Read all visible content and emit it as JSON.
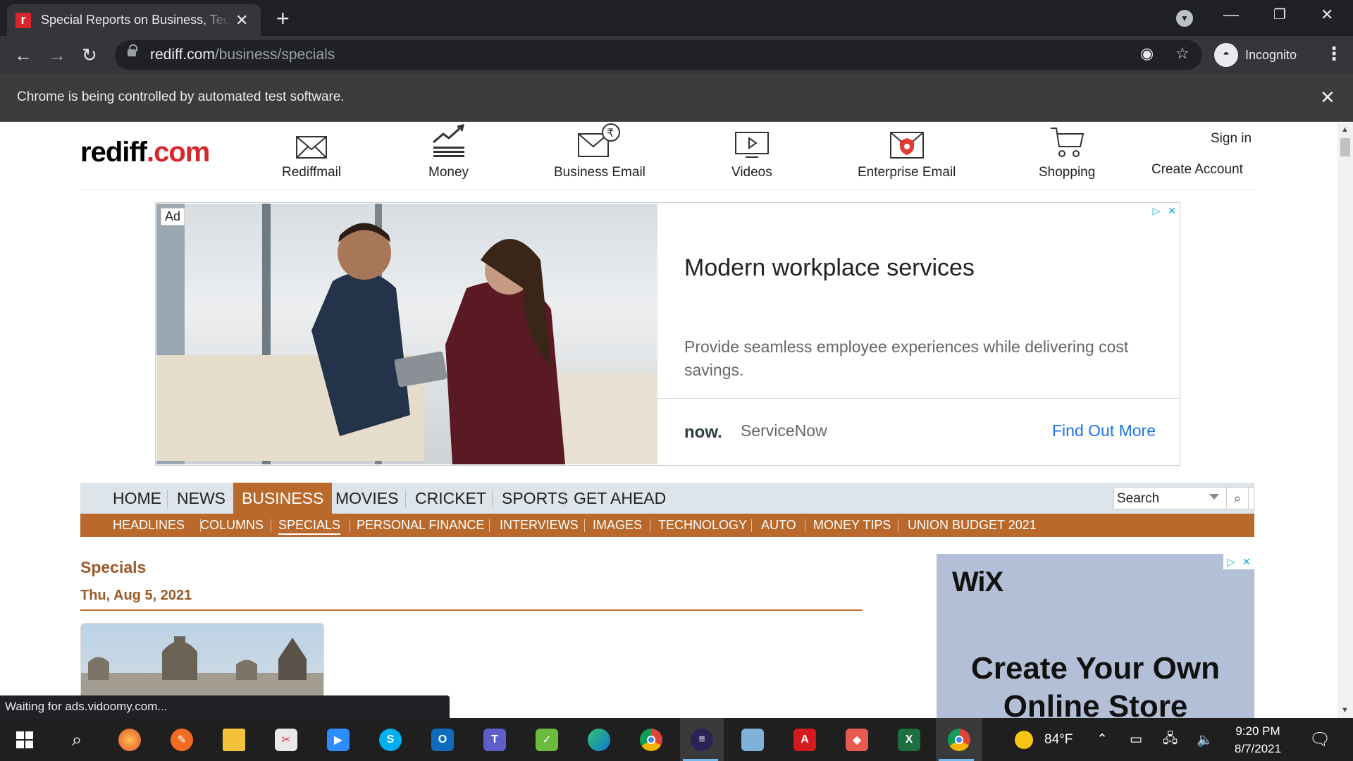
{
  "browser": {
    "tab_title": "Special Reports on Business, Tech",
    "url_host": "rediff.com",
    "url_path": "/business/specials",
    "profile_label": "Incognito",
    "infobar_text": "Chrome is being controlled by automated test software."
  },
  "header": {
    "logo_main": "rediff",
    "logo_tld": ".com",
    "nav": [
      {
        "label": "Rediffmail",
        "icon": "mail-icon"
      },
      {
        "label": "Money",
        "icon": "money-chart-icon"
      },
      {
        "label": "Business Email",
        "icon": "business-email-icon"
      },
      {
        "label": "Videos",
        "icon": "video-icon"
      },
      {
        "label": "Enterprise Email",
        "icon": "enterprise-email-icon"
      },
      {
        "label": "Shopping",
        "icon": "cart-icon"
      }
    ],
    "sign_in": "Sign in",
    "create_account": "Create Account"
  },
  "ad": {
    "badge": "Ad",
    "title": "Modern workplace services",
    "description": "Provide seamless employee experiences while delivering cost savings.",
    "brand_logo": "now.",
    "brand": "ServiceNow",
    "cta": "Find Out More"
  },
  "main_nav": {
    "items": [
      "HOME",
      "NEWS",
      "BUSINESS",
      "MOVIES",
      "CRICKET",
      "SPORTS",
      "GET AHEAD"
    ],
    "active": "BUSINESS",
    "search_placeholder": "Search"
  },
  "sub_nav": {
    "items": [
      "HEADLINES",
      "COLUMNS",
      "SPECIALS",
      "PERSONAL FINANCE",
      "INTERVIEWS",
      "IMAGES",
      "TECHNOLOGY",
      "AUTO",
      "MONEY TIPS",
      "UNION BUDGET 2021"
    ],
    "active": "SPECIALS"
  },
  "content": {
    "section_title": "Specials",
    "date": "Thu, Aug 5, 2021"
  },
  "side_ad": {
    "logo": "WiX",
    "headline_line1": "Create Your Own",
    "headline_line2": "Online Store"
  },
  "status_text": "Waiting for ads.vidoomy.com...",
  "taskbar": {
    "weather": "84°F",
    "time": "9:20 PM",
    "date": "8/7/2021"
  },
  "colors": {
    "brand_red": "#d7262c",
    "business_accent": "#b9692b",
    "nav_bg": "#dde4ea",
    "link_blue": "#1a73e8"
  }
}
